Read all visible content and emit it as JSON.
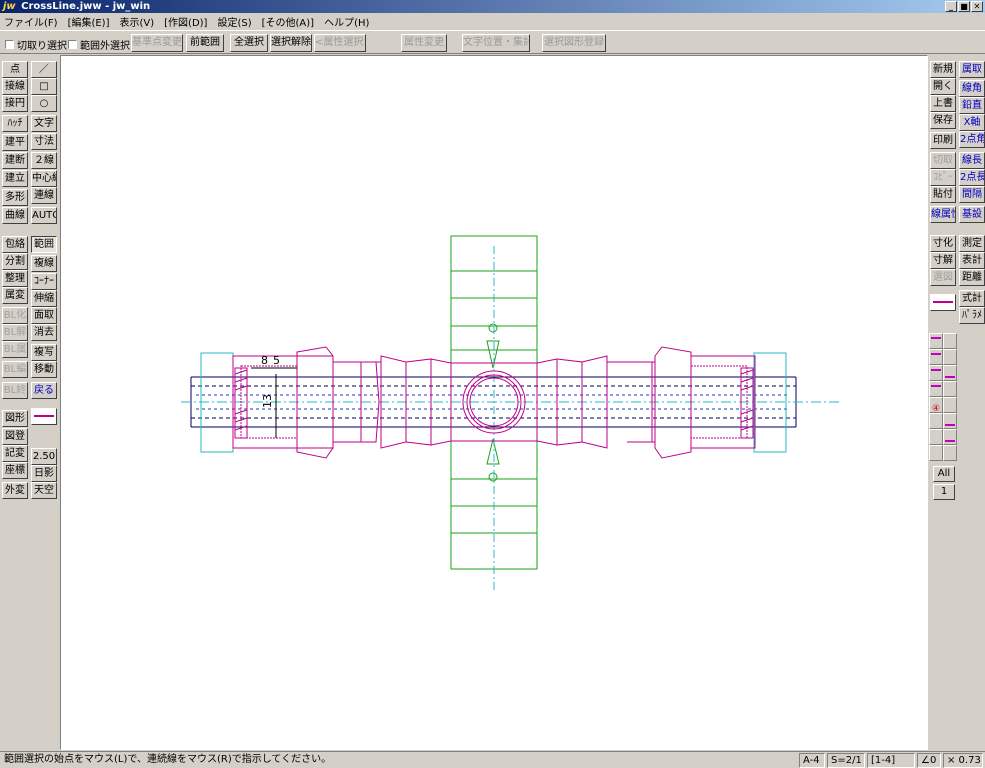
{
  "window": {
    "app_icon": "jw",
    "title": "CrossLine.jww - jw_win",
    "buttons": [
      "_",
      "■",
      "✕"
    ]
  },
  "menu": [
    "ファイル(F)",
    "[編集(E)]",
    "表示(V)",
    "[作図(D)]",
    "設定(S)",
    "[その他(A)]",
    "ヘルプ(H)"
  ],
  "top_toolbar": {
    "checkbox1": "切取り選択",
    "checkbox2": "範囲外選択",
    "buttons": [
      "基準点変更",
      "前範囲",
      "全選択",
      "選択解除",
      "<属性選択>",
      "属性変更",
      "文字位置・集計",
      "選択図形登録"
    ]
  },
  "left_tools_a": [
    "点",
    "接線",
    "接円",
    "ﾊｯﾁ",
    "建平",
    "建断",
    "建立",
    "多形",
    "曲線",
    "包絡",
    "分割",
    "整理",
    "属変",
    "BL化",
    "BL解",
    "BL属",
    "BL編",
    "BL終",
    "図形",
    "図登",
    "記変",
    "座標",
    "外変"
  ],
  "left_tools_b": [
    "／",
    "□",
    "○",
    "文字",
    "寸法",
    "２線",
    "中心線",
    "連線",
    "AUTO",
    "範囲",
    "複線",
    "ｺｰﾅｰ",
    "伸縮",
    "面取",
    "消去",
    "複写",
    "移動",
    "戻る",
    "2.50",
    "日影",
    "天空"
  ],
  "right_tools_a": [
    "新規",
    "開く",
    "上書",
    "保存",
    "印刷",
    "切取",
    "ｺﾋﾟｰ",
    "貼付",
    "線属性",
    "寸化",
    "寸解",
    "選図"
  ],
  "right_tools_b": [
    "線角",
    "鉛直",
    "X軸",
    "2点角",
    "線長",
    "2点長",
    "間隔",
    "基設",
    "測定",
    "表計",
    "距離",
    "式計",
    "ﾊﾟﾗﾒ"
  ],
  "right_tools_b_top": "属取",
  "layers": {
    "active": "④",
    "all_label": "All",
    "group_label": "1"
  },
  "drawing": {
    "dim1": "8",
    "dim2": "5",
    "dim3": "13"
  },
  "status": {
    "message": "範囲選択の始点をマウス(L)で、連続線をマウス(R)で指示してください。",
    "paper": "A-4",
    "scale": "S=2/1",
    "layer": "[1-4]",
    "angle": "∠0",
    "zoom": "× 0.73"
  },
  "colors": {
    "pink": "#c0008a",
    "cyan": "#2ab8c8",
    "green": "#1aa31a",
    "navy": "#000060",
    "blue_dash": "#1040c0"
  }
}
